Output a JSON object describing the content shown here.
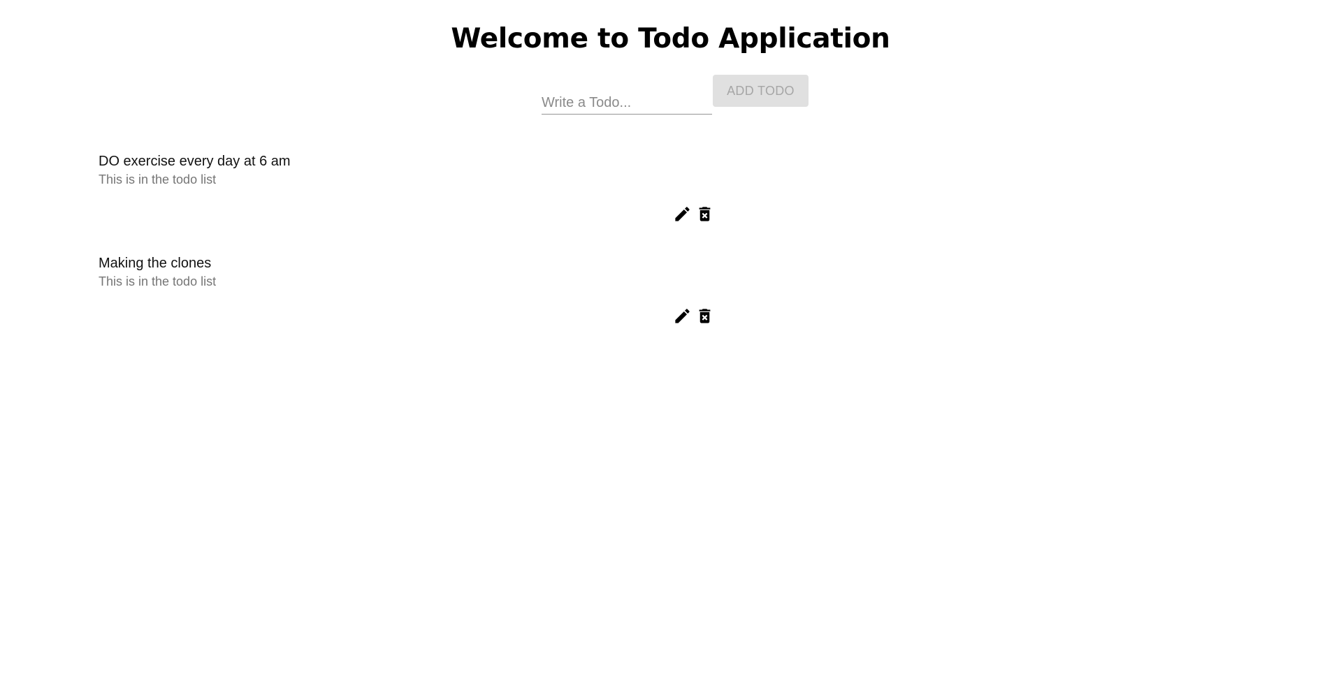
{
  "header": {
    "title": "Welcome to Todo Application"
  },
  "form": {
    "placeholder": "Write a Todo...",
    "value": "",
    "add_label": "ADD TODO"
  },
  "todos": [
    {
      "text": "DO exercise every day at 6 am",
      "subtitle": "This is in the todo list"
    },
    {
      "text": "Making the clones",
      "subtitle": "This is in the todo list"
    }
  ],
  "icons": {
    "edit": "pencil-icon",
    "delete": "delete-forever-icon"
  },
  "colors": {
    "button_disabled_bg": "#e0e0e0",
    "button_disabled_text": "#a6a6a6",
    "subtitle": "#757575"
  }
}
